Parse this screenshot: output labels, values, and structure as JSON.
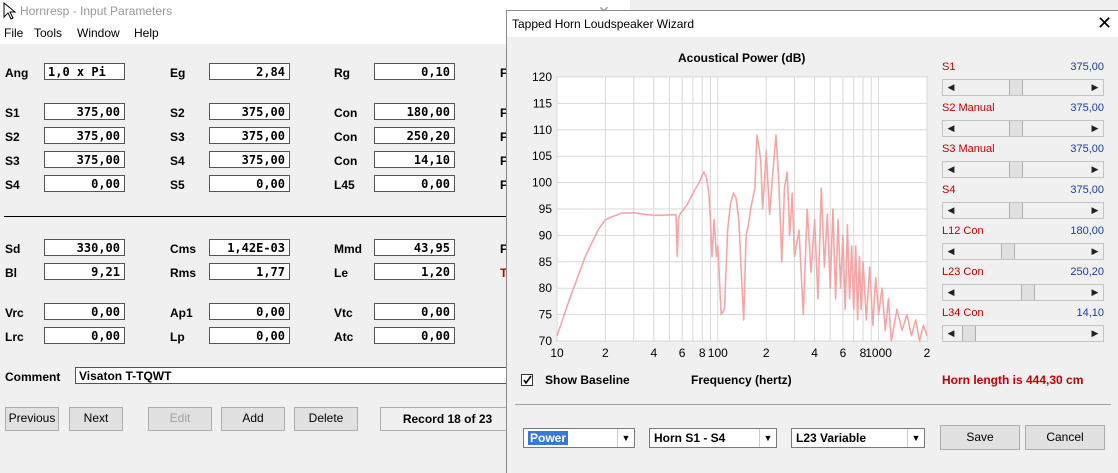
{
  "back": {
    "title": "Hornresp - Input Parameters",
    "menu": [
      "File",
      "Tools",
      "Window",
      "Help"
    ],
    "rows": [
      [
        {
          "l": "Ang",
          "v": "1,0 x Pi"
        },
        {
          "l": "Eg",
          "v": "2,84"
        },
        {
          "l": "Rg",
          "v": "0,10"
        }
      ],
      [
        {
          "l": "S1",
          "v": "375,00"
        },
        {
          "l": "S2",
          "v": "375,00"
        },
        {
          "l": "Con",
          "v": "180,00"
        }
      ],
      [
        {
          "l": "S2",
          "v": "375,00"
        },
        {
          "l": "S3",
          "v": "375,00"
        },
        {
          "l": "Con",
          "v": "250,20"
        }
      ],
      [
        {
          "l": "S3",
          "v": "375,00"
        },
        {
          "l": "S4",
          "v": "375,00"
        },
        {
          "l": "Con",
          "v": "14,10"
        }
      ],
      [
        {
          "l": "S4",
          "v": "0,00"
        },
        {
          "l": "S5",
          "v": "0,00"
        },
        {
          "l": "L45",
          "v": "0,00"
        }
      ],
      [
        {
          "l": "Sd",
          "v": "330,00"
        },
        {
          "l": "Cms",
          "v": "1,42E-03"
        },
        {
          "l": "Mmd",
          "v": "43,95"
        }
      ],
      [
        {
          "l": "Bl",
          "v": "9,21"
        },
        {
          "l": "Rms",
          "v": "1,77"
        },
        {
          "l": "Le",
          "v": "1,20"
        }
      ],
      [
        {
          "l": "Vrc",
          "v": "0,00"
        },
        {
          "l": "Ap1",
          "v": "0,00"
        },
        {
          "l": "Vtc",
          "v": "0,00"
        }
      ],
      [
        {
          "l": "Lrc",
          "v": "0,00"
        },
        {
          "l": "Lp",
          "v": "0,00"
        },
        {
          "l": "Atc",
          "v": "0,00"
        }
      ]
    ],
    "comment_label": "Comment",
    "comment_value": "Visaton T-TQWT",
    "buttons": {
      "previous": "Previous",
      "next": "Next",
      "edit": "Edit",
      "add": "Add",
      "delete": "Delete"
    },
    "record": "Record 18 of 23"
  },
  "wizard": {
    "title": "Tapped Horn Loudspeaker Wizard",
    "close": "✕",
    "show_baseline": "Show Baseline",
    "baseline_checked": true,
    "horn_length": "Horn length is 444,30 cm",
    "sliders": [
      {
        "label": "S1",
        "value": "375,00",
        "pos": 0.44
      },
      {
        "label": "S2 Manual",
        "value": "375,00",
        "pos": 0.44
      },
      {
        "label": "S3 Manual",
        "value": "375,00",
        "pos": 0.44
      },
      {
        "label": "S4",
        "value": "375,00",
        "pos": 0.44
      },
      {
        "label": "L12 Con",
        "value": "180,00",
        "pos": 0.37
      },
      {
        "label": "L23 Con",
        "value": "250,20",
        "pos": 0.54
      },
      {
        "label": "L34 Con",
        "value": "14,10",
        "pos": 0.03
      }
    ],
    "combos": {
      "mode": "Power",
      "horn": "Horn S1 - S4",
      "variable": "L23 Variable"
    },
    "save": "Save",
    "cancel": "Cancel"
  },
  "chart_data": {
    "type": "line",
    "title": "Acoustical Power (dB)",
    "xlabel": "Frequency (hertz)",
    "ylabel": "",
    "x_scale": "log",
    "xlim": [
      10,
      2000
    ],
    "ylim": [
      70,
      120
    ],
    "yticks": [
      "120",
      "115",
      "110",
      "105",
      "100",
      "95",
      "90",
      "85",
      "80",
      "75",
      "70"
    ],
    "xticks": [
      "10",
      "2",
      "4",
      "6",
      "8",
      "100",
      "2",
      "4",
      "6",
      "8",
      "1000",
      "2"
    ],
    "grid": true,
    "line_color": "#f4a6a6",
    "series": [
      {
        "x": [
          10,
          12,
          15,
          18,
          20,
          25,
          30,
          35,
          40,
          45,
          50,
          55,
          56,
          57,
          58,
          60,
          65,
          70,
          75,
          78,
          80,
          82,
          85,
          88,
          90,
          92,
          95,
          98,
          100,
          105,
          110,
          115,
          120,
          125,
          130,
          135,
          140,
          145,
          150,
          155,
          160,
          165,
          170,
          175,
          180,
          185,
          190,
          195,
          200,
          210,
          220,
          230,
          240,
          250,
          260,
          270,
          280,
          290,
          300,
          320,
          340,
          360,
          380,
          400,
          420,
          440,
          460,
          480,
          500,
          520,
          540,
          560,
          580,
          600,
          620,
          640,
          660,
          680,
          700,
          720,
          740,
          760,
          780,
          800,
          840,
          880,
          920,
          960,
          1000,
          1050,
          1100,
          1150,
          1200,
          1300,
          1400,
          1500,
          1600,
          1700,
          1800,
          1900,
          2000
        ],
        "y": [
          71,
          78,
          86,
          91,
          93,
          94.2,
          94.3,
          94,
          93.8,
          93.8,
          93.9,
          93.9,
          86,
          93,
          94,
          94.5,
          96,
          98,
          99.5,
          100.5,
          101.5,
          102,
          101,
          98,
          93,
          86,
          93,
          86,
          88,
          75,
          76,
          91,
          96,
          98,
          97,
          93,
          83,
          74,
          90,
          92,
          95,
          97,
          99,
          109,
          107,
          104,
          95,
          100,
          106,
          94,
          102,
          109,
          100,
          85,
          99,
          102,
          90,
          98,
          86,
          91,
          75,
          95,
          83,
          93,
          78,
          99,
          84,
          94,
          80,
          95,
          78,
          93,
          80,
          90,
          76,
          92,
          78,
          88,
          76,
          88,
          74,
          86,
          76,
          85,
          74,
          84,
          73,
          82,
          75,
          80,
          72,
          78,
          70,
          76,
          72,
          75,
          71,
          74,
          70,
          73,
          71
        ]
      }
    ]
  }
}
